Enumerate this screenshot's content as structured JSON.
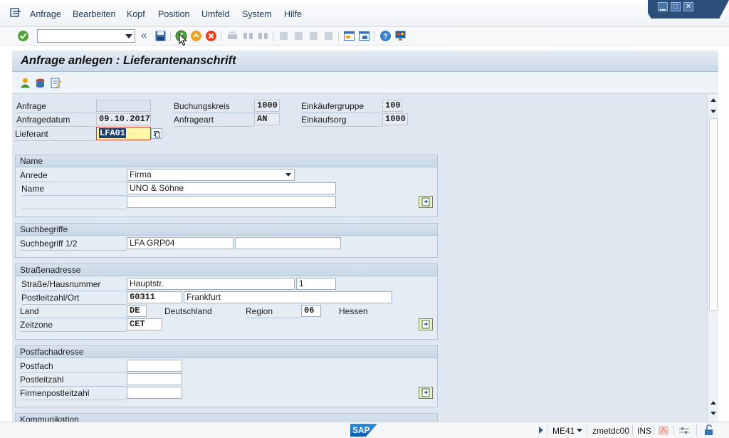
{
  "menu": {
    "items": [
      "Anfrage",
      "Bearbeiten",
      "Kopf",
      "Position",
      "Umfeld",
      "System",
      "Hilfe"
    ]
  },
  "toolbar": {
    "command_field_value": ""
  },
  "title": "Anfrage anlegen : Lieferantenanschrift",
  "header": {
    "anfrage_label": "Anfrage",
    "anfrage_value": "",
    "anfragedatum_label": "Anfragedatum",
    "anfragedatum_value": "09.10.2017",
    "lieferant_label": "Lieferant",
    "lieferant_value": "LFA01",
    "buchungskreis_label": "Buchungskreis",
    "buchungskreis_value": "1000",
    "anfrageart_label": "Anfrageart",
    "anfrageart_value": "AN",
    "einkaeufergruppe_label": "Einkäufergruppe",
    "einkaeufergruppe_value": "100",
    "einkaufsorg_label": "Einkaufsorg",
    "einkaufsorg_value": "1000"
  },
  "name_group": {
    "title": "Name",
    "anrede_label": "Anrede",
    "anrede_value": "Firma",
    "name_label": "Name",
    "name_value": "UNO & Söhne",
    "name2_value": ""
  },
  "search_group": {
    "title": "Suchbegriffe",
    "label": "Suchbegriff 1/2",
    "value1": "LFA GRP04",
    "value2": ""
  },
  "street_group": {
    "title": "Straßenadresse",
    "street_label": "Straße/Hausnummer",
    "street_value": "Hauptstr.",
    "house_value": "1",
    "plz_label": "Postleitzahl/Ort",
    "plz_value": "60311",
    "city_value": "Frankfurt",
    "land_label": "Land",
    "land_value": "DE",
    "land_text": "Deutschland",
    "region_label": "Region",
    "region_value": "06",
    "region_text": "Hessen",
    "zeitzone_label": "Zeitzone",
    "zeitzone_value": "CET"
  },
  "pobox_group": {
    "title": "Postfachadresse",
    "postfach_label": "Postfach",
    "postfach_value": "",
    "postleitzahl_label": "Postleitzahl",
    "postleitzahl_value": "",
    "firmenplz_label": "Firmenpostleitzahl",
    "firmenplz_value": ""
  },
  "comm_group": {
    "title": "Kommunikation"
  },
  "status": {
    "transaction": "ME41",
    "server": "zmetdc00",
    "mode": "INS"
  },
  "logo_text": "SAP",
  "colors": {
    "title_bg": "#c9d8e7",
    "group_header": "#d6e2ed",
    "content_bg": "#dfe8f1",
    "focus_field": "#fff6a8"
  }
}
